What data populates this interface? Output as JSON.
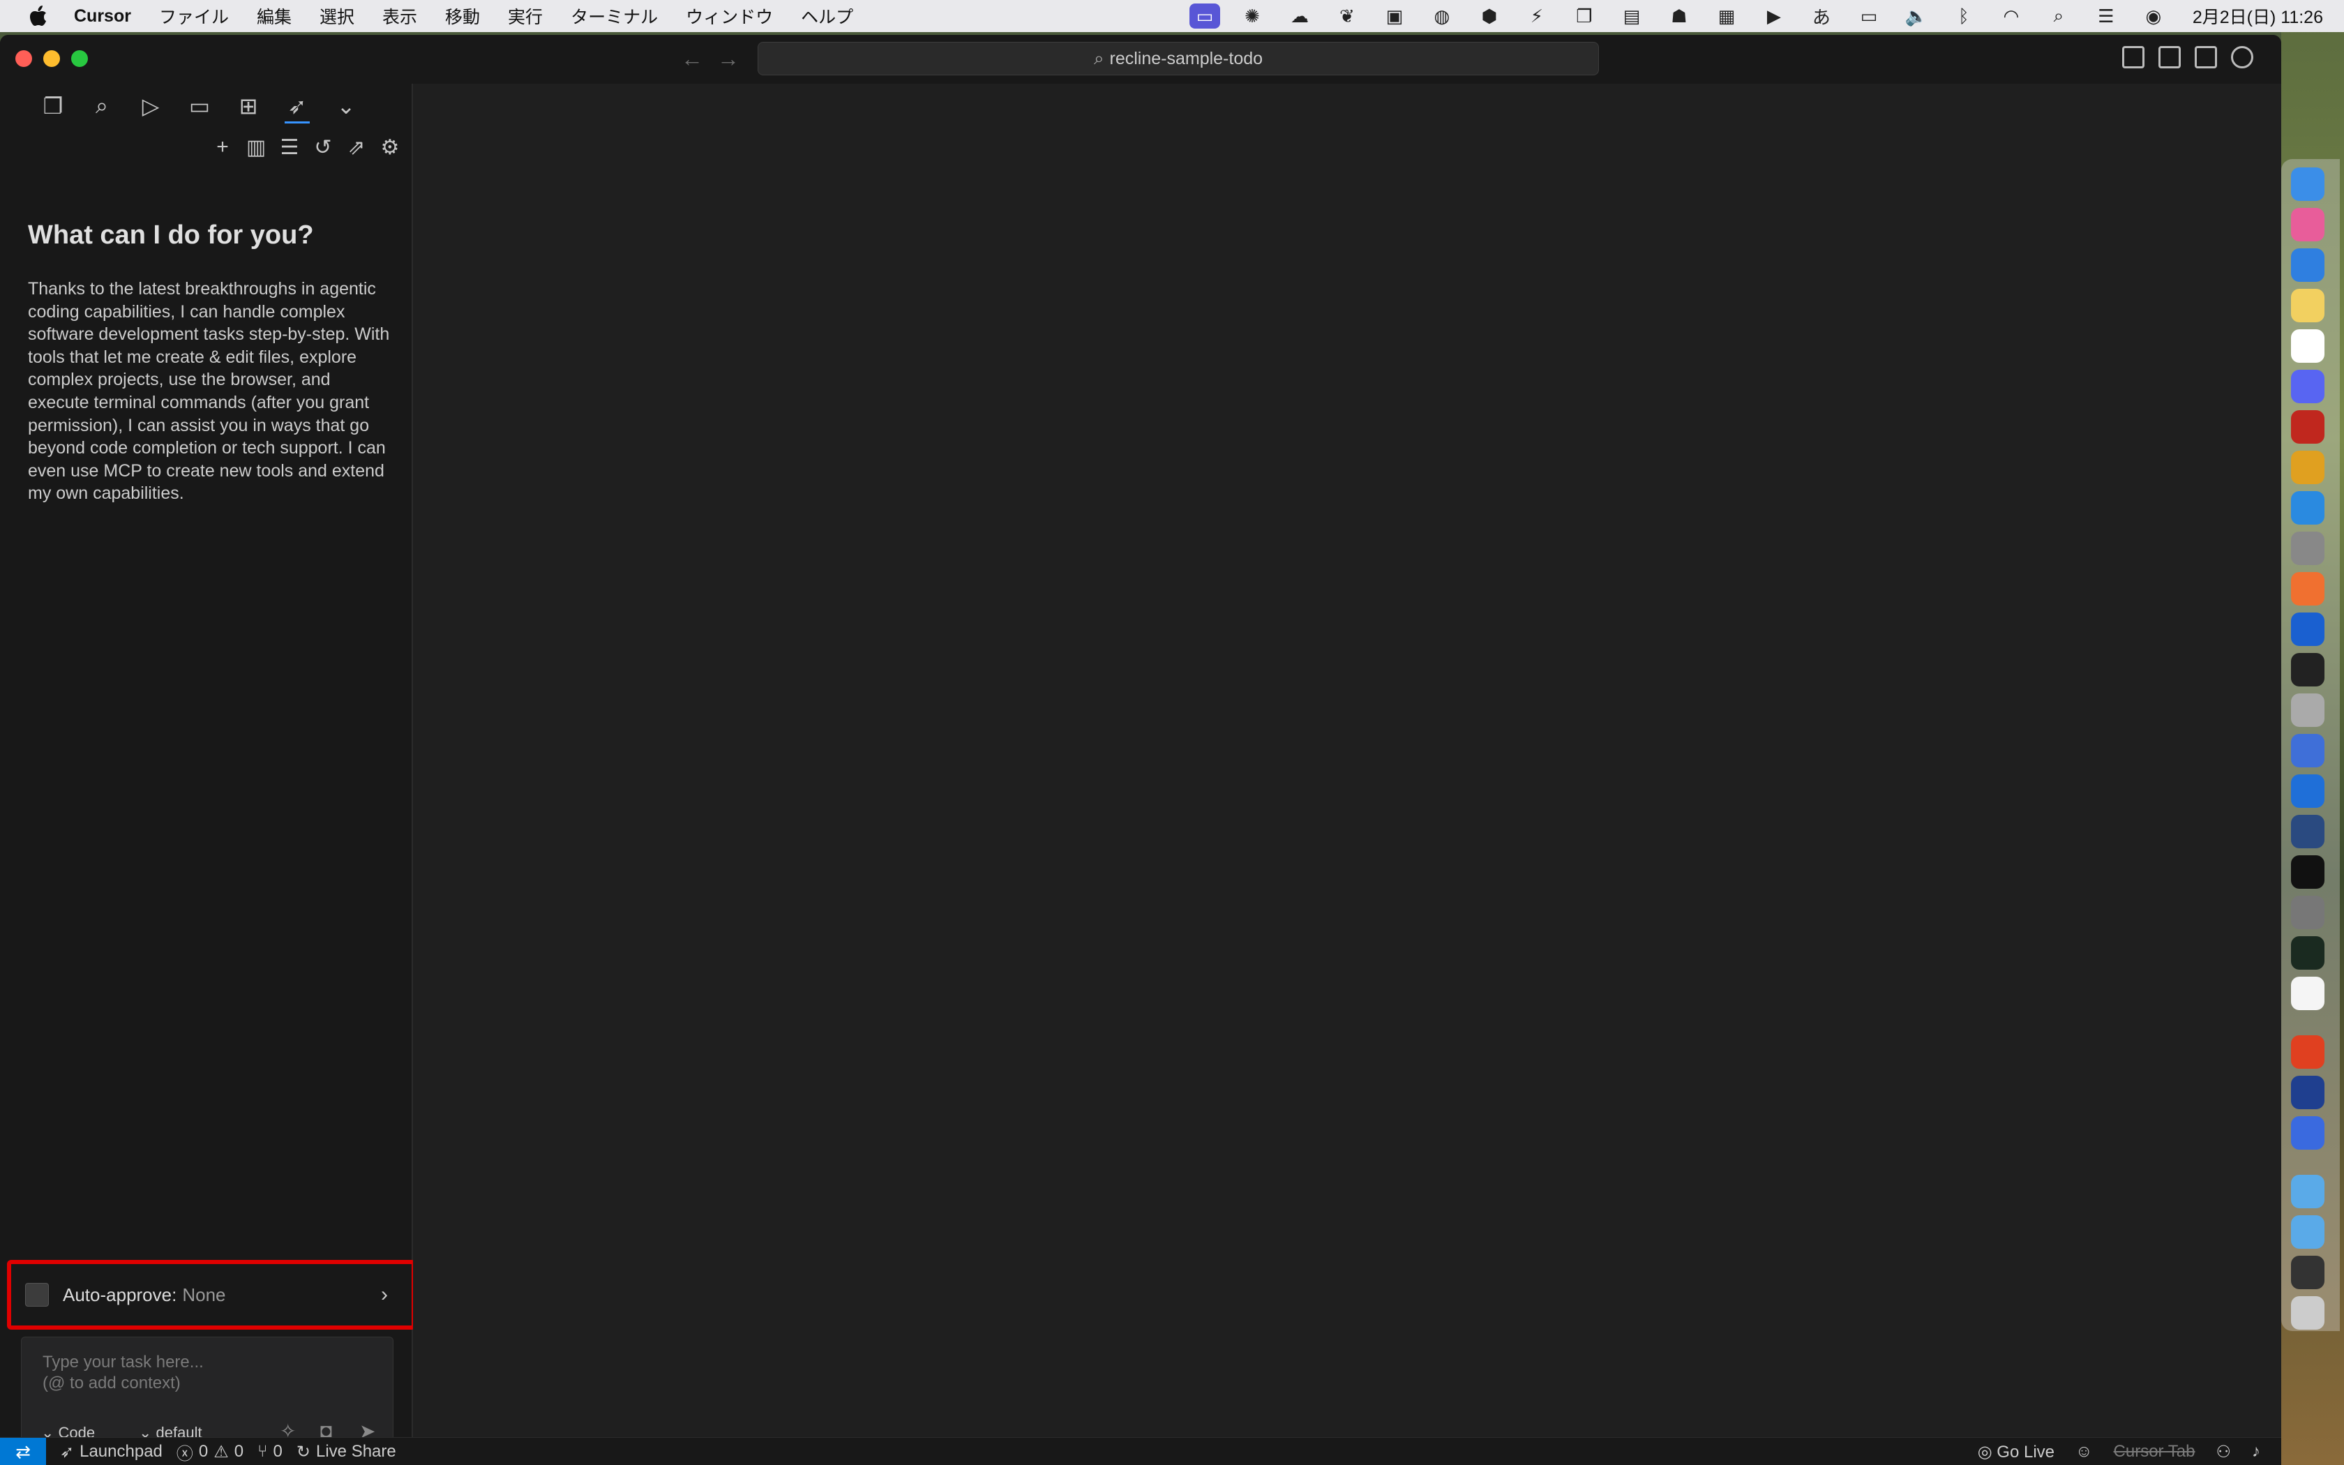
{
  "menubar": {
    "app_name": "Cursor",
    "menus": [
      "ファイル",
      "編集",
      "選択",
      "表示",
      "移動",
      "実行",
      "ターミナル",
      "ウィンドウ",
      "ヘルプ"
    ],
    "clock": "2月2日(日) 11:26"
  },
  "titlebar": {
    "command_center": "recline-sample-todo"
  },
  "sidebar": {
    "welcome_title": "What can I do for you?",
    "welcome_body": "Thanks to the latest breakthroughs in agentic coding capabilities, I can handle complex software development tasks step-by-step. With tools that let me create & edit files, explore complex projects, use the browser, and execute terminal commands (after you grant permission), I can assist you in ways that go beyond code completion or tech support. I can even use MCP to create new tools and extend my own capabilities.",
    "auto_approve": {
      "label": "Auto-approve:",
      "value": "None"
    },
    "task_input": {
      "placeholder_line1": "Type your task here...",
      "placeholder_line2": "(@ to add context)",
      "mode": "Code",
      "profile": "default"
    }
  },
  "statusbar": {
    "launchpad": "Launchpad",
    "errors": "0",
    "warnings": "0",
    "ports": "0",
    "live_share": "Live Share",
    "go_live": "Go Live",
    "cursor_tab": "Cursor Tab"
  },
  "colors": {
    "accent": "#0078d4",
    "highlight_border": "#e00000",
    "sidebar_bg": "#181818",
    "editor_bg": "#1f1f1f"
  }
}
